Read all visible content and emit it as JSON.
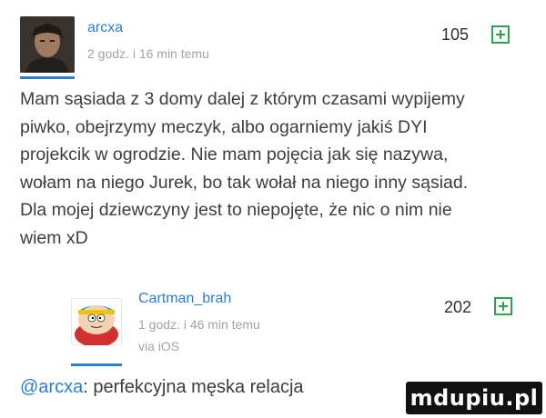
{
  "comments": [
    {
      "username": "arcxa",
      "time": "2 godz. i 16 min temu",
      "score": "105",
      "avatar_icon": "user-avatar-man-dark-hair",
      "text": "Mam sąsiada z 3 domy dalej z którym czasami wypijemy\npiwko, obejrzymy meczyk, albo ogarniemy jakiś DYI\nprojekcik w ogrodzie. Nie mam pojęcia jak się nazywa,\nwołam na niego Jurek, bo tak wołał na niego inny sąsiad.\nDla mojej dziewczyny jest to niepojęte, że nic o nim nie\nwiem xD"
    },
    {
      "username": "Cartman_brah",
      "time": "1 godz. i 46 min temu",
      "device": "via iOS",
      "score": "202",
      "avatar_icon": "user-avatar-cartoon-cartman",
      "mention": "@arcxa",
      "text": ": perfekcyjna męska relacja"
    }
  ],
  "watermark": "mdupiu.pl",
  "colors": {
    "accent": "#2b7fd0",
    "plus": "#2ca24c",
    "meta": "#a3a3a3"
  }
}
